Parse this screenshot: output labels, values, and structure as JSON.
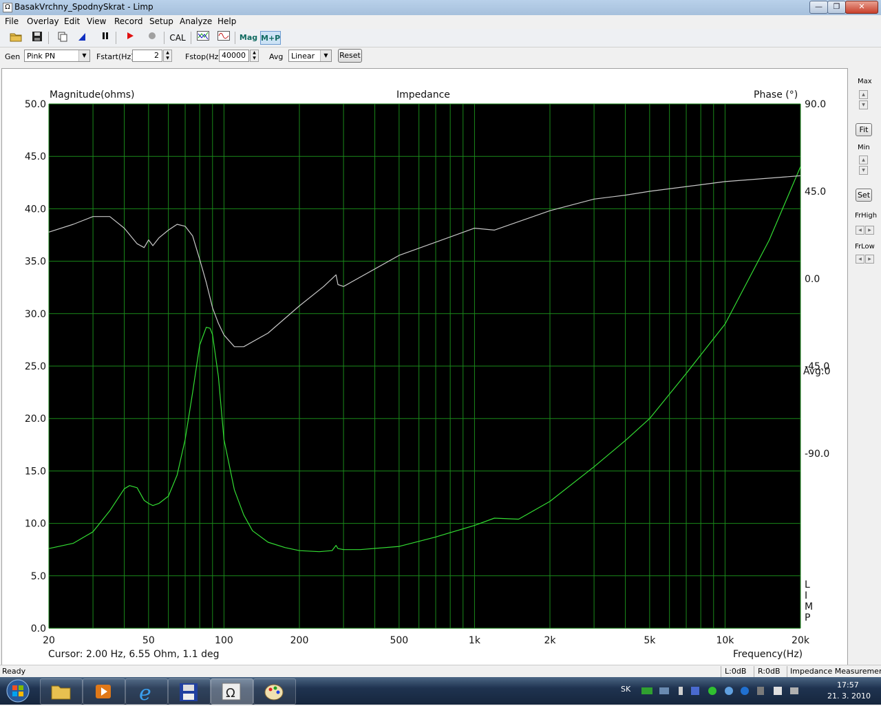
{
  "window": {
    "title": "BasakVrchny_SpodnySkrat - Limp",
    "minimize": "—",
    "maximize": "❐",
    "close": "✕"
  },
  "menu": [
    "File",
    "Overlay",
    "Edit",
    "View",
    "Record",
    "Setup",
    "Analyze",
    "Help"
  ],
  "toolbar": {
    "cal_label": "CAL",
    "mag_label": "Mag",
    "mp_label": "M+P"
  },
  "genbar": {
    "gen_label": "Gen",
    "gen_value": "Pink PN",
    "fstart_label": "Fstart(Hz)",
    "fstart_value": "2",
    "fstop_label": "Fstop(Hz)",
    "fstop_value": "40000",
    "avg_label": "Avg",
    "avg_value": "Linear",
    "reset_label": "Reset"
  },
  "plot": {
    "left_axis_title": "Magnitude(ohms)",
    "center_title": "Impedance",
    "right_axis_title": "Phase (°)",
    "avg_text": "Avg:0",
    "limp_letters": [
      "L",
      "I",
      "M",
      "P"
    ],
    "cursor_text": "Cursor: 2.00 Hz, 6.55 Ohm, 1.1 deg",
    "x_axis_title": "Frequency(Hz)"
  },
  "right_panel": {
    "max_label": "Max",
    "fit_label": "Fit",
    "min_label": "Min",
    "set_label": "Set",
    "frhigh_label": "FrHigh",
    "frlow_label": "FrLow"
  },
  "status": {
    "ready": "Ready",
    "left_db": "L:0dB",
    "right_db": "R:0dB",
    "mode": "Impedance Measuremen"
  },
  "taskbar": {
    "lang": "SK",
    "time": "17:57",
    "date": "21. 3. 2010"
  },
  "chart_data": {
    "type": "line",
    "x_scale": "log",
    "xlim": [
      20,
      20000
    ],
    "x_ticks": [
      20,
      50,
      100,
      200,
      500,
      1000,
      2000,
      5000,
      10000,
      20000
    ],
    "x_tick_labels": [
      "20",
      "50",
      "100",
      "200",
      "500",
      "1k",
      "2k",
      "5k",
      "10k",
      "20k"
    ],
    "ylim": [
      0,
      50
    ],
    "y_tick_labels": [
      "0.0",
      "5.0",
      "10.0",
      "15.0",
      "20.0",
      "25.0",
      "30.0",
      "35.0",
      "40.0",
      "45.0",
      "50.0"
    ],
    "y2lim": [
      -180,
      90
    ],
    "y2_tick_values": [
      90,
      45,
      0,
      -45,
      -90
    ],
    "y2_tick_labels": [
      "90.0",
      "45.0",
      "0.0",
      "-45.0",
      "-90.0"
    ],
    "grid": true,
    "colors": {
      "magnitude": "#33dd33",
      "phase": "#c8c8c8",
      "grid": "#1a8a1a",
      "background": "#000000"
    },
    "series": [
      {
        "axis": "left",
        "x": [
          20,
          25,
          30,
          35,
          40,
          42,
          45,
          48,
          50,
          52,
          55,
          60,
          65,
          70,
          75,
          80,
          85,
          88,
          90,
          95,
          100,
          110,
          120,
          130,
          150,
          175,
          200,
          240,
          270,
          280,
          285,
          300,
          350,
          500,
          700,
          1000,
          1200,
          1500,
          2000,
          3000,
          4000,
          5000,
          7000,
          10000,
          15000,
          20000
        ],
        "y": [
          7.6,
          8.1,
          9.2,
          11.2,
          13.3,
          13.6,
          13.4,
          12.2,
          11.9,
          11.7,
          11.9,
          12.6,
          14.6,
          18.0,
          22.5,
          27.0,
          28.7,
          28.6,
          28.0,
          24.0,
          18.0,
          13.2,
          10.8,
          9.3,
          8.2,
          7.7,
          7.4,
          7.3,
          7.4,
          7.9,
          7.6,
          7.5,
          7.5,
          7.8,
          8.7,
          9.8,
          10.5,
          10.4,
          12.1,
          15.4,
          17.9,
          20.0,
          24.3,
          29.0,
          37.0,
          44.0
        ]
      },
      {
        "axis": "right",
        "x": [
          20,
          25,
          30,
          35,
          40,
          45,
          48,
          50,
          52,
          55,
          60,
          65,
          70,
          75,
          80,
          85,
          90,
          95,
          100,
          110,
          120,
          150,
          200,
          250,
          280,
          285,
          300,
          500,
          1000,
          1200,
          2000,
          3000,
          4000,
          5000,
          10000,
          20000
        ],
        "y": [
          24,
          28,
          32,
          32,
          26,
          18,
          16,
          20,
          17,
          21,
          25,
          28,
          27,
          22,
          10,
          -2,
          -15,
          -23,
          -29,
          -35,
          -35,
          -28,
          -14,
          -4,
          2,
          -3,
          -4,
          12,
          26,
          25,
          35,
          41,
          43,
          45,
          50,
          53
        ]
      }
    ]
  }
}
